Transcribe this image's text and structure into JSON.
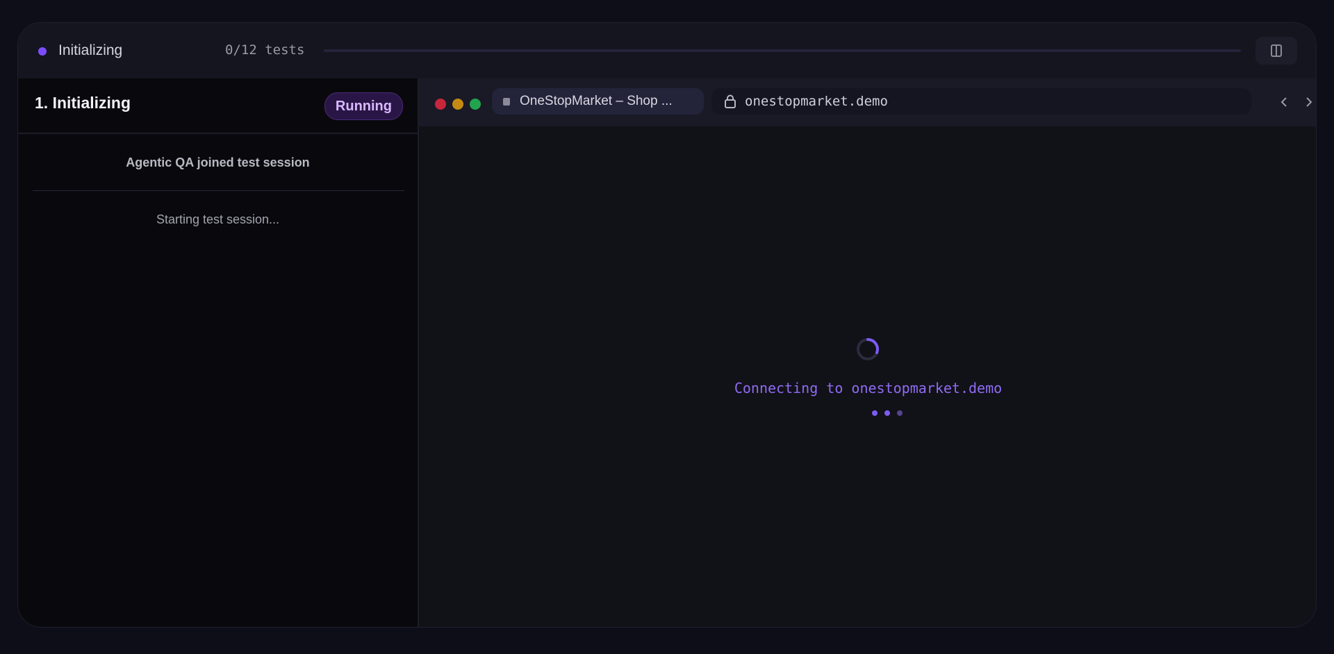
{
  "status": {
    "label": "Initializing",
    "dot_color": "#7c4dff",
    "test_count": "0/12 tests",
    "progress": 0
  },
  "step": {
    "title": "1. Initializing",
    "badge": "Running"
  },
  "log": {
    "joined": "Agentic QA joined test session",
    "starting": "Starting test session..."
  },
  "browser": {
    "tab_title": "OneStopMarket – Shop ...",
    "address": "onestopmarket.demo",
    "connecting": "Connecting to onestopmarket.demo"
  },
  "icons": {
    "panel_toggle": "panel-toggle-icon",
    "lock": "lock-icon",
    "back": "chevron-left-icon",
    "forward": "chevron-right-icon",
    "spinner": "spinner-icon"
  }
}
